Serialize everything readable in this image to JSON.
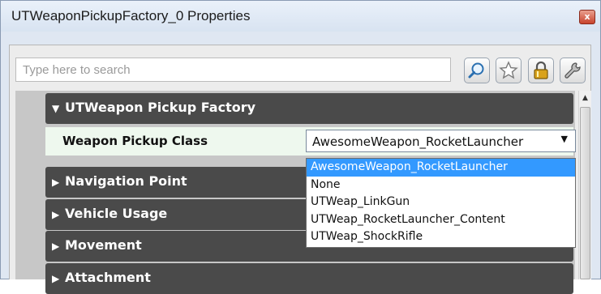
{
  "window": {
    "title": "UTWeaponPickupFactory_0 Properties",
    "close_glyph": "x"
  },
  "toolbar": {
    "search_placeholder": "Type here to search",
    "buttons": [
      {
        "icon": "search-icon"
      },
      {
        "icon": "star-icon"
      },
      {
        "icon": "lock-icon"
      },
      {
        "icon": "wrench-icon"
      }
    ]
  },
  "sections": [
    {
      "label": "UTWeapon Pickup Factory",
      "expanded": true
    },
    {
      "label": "Navigation Point",
      "expanded": false
    },
    {
      "label": "Vehicle Usage",
      "expanded": false
    },
    {
      "label": "Movement",
      "expanded": false
    },
    {
      "label": "Attachment",
      "expanded": false
    }
  ],
  "property": {
    "label": "Weapon Pickup Class",
    "value": "AwesomeWeapon_RocketLauncher"
  },
  "dropdown": {
    "options": [
      "AwesomeWeapon_RocketLauncher",
      "None",
      "UTWeap_LinkGun",
      "UTWeap_RocketLauncher_Content",
      "UTWeap_ShockRifle"
    ],
    "selected_index": 0
  },
  "colors": {
    "section_bg": "#4a4a4a",
    "selected_bg": "#3399ff",
    "row_highlight": "#eef8ee"
  }
}
